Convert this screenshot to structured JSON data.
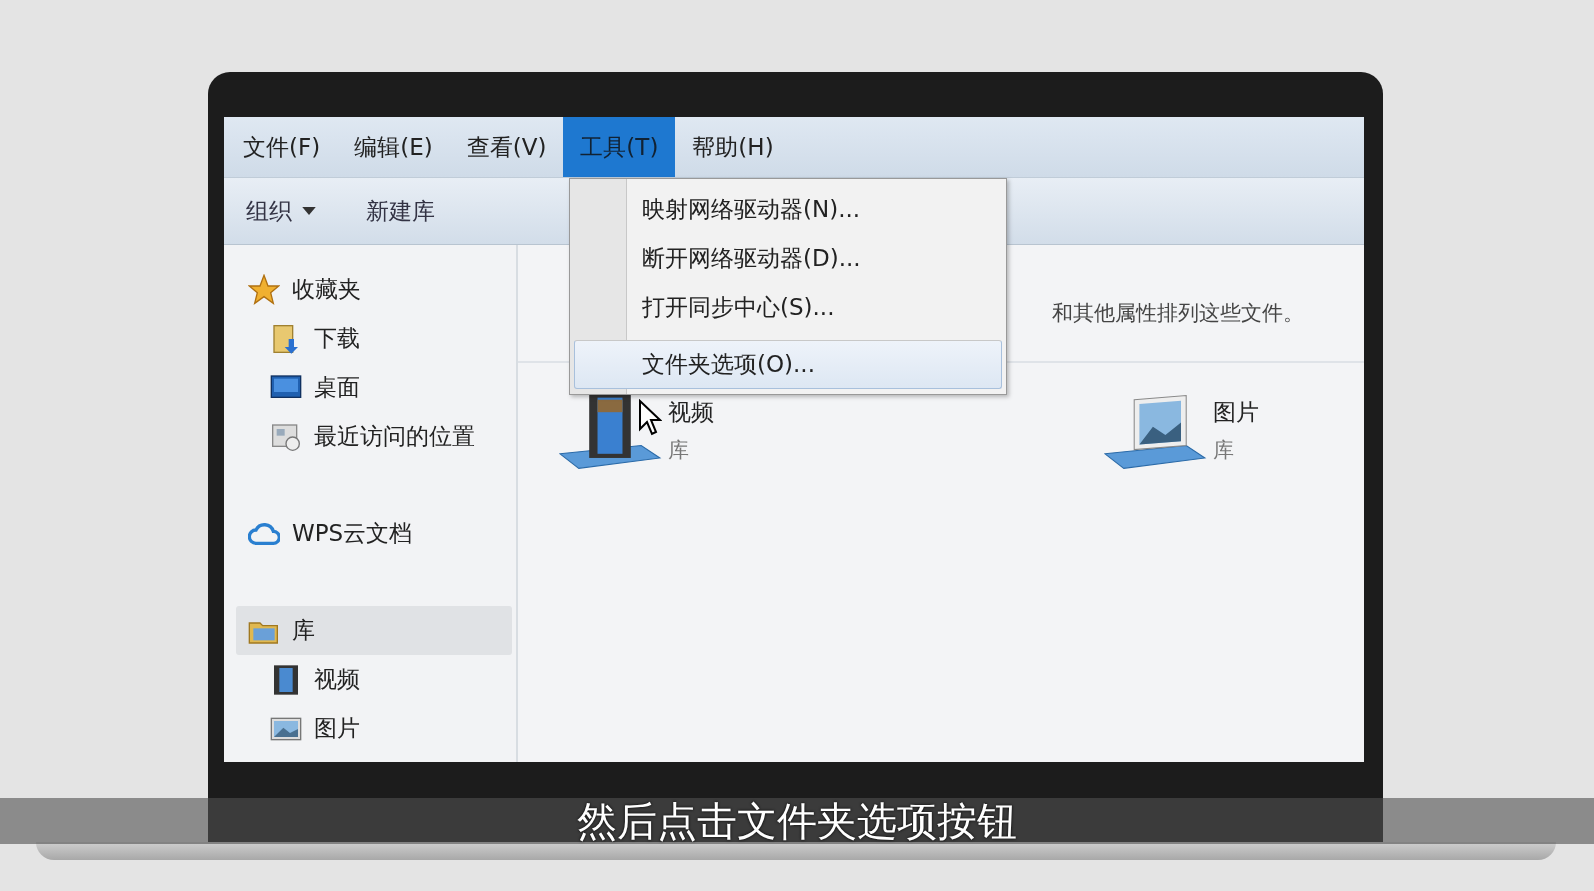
{
  "menubar": [
    {
      "label": "文件(F)",
      "selected": false
    },
    {
      "label": "编辑(E)",
      "selected": false
    },
    {
      "label": "查看(V)",
      "selected": false
    },
    {
      "label": "工具(T)",
      "selected": true
    },
    {
      "label": "帮助(H)",
      "selected": false
    }
  ],
  "toolbar": {
    "buttons": [
      {
        "label": "组织",
        "dropdown": true
      },
      {
        "label": "新建库",
        "dropdown": false
      }
    ]
  },
  "sidebar": {
    "items": [
      {
        "label": "收藏夹",
        "kind": "star",
        "selected": false,
        "children": [
          {
            "label": "下载",
            "kind": "download",
            "selected": false
          },
          {
            "label": "桌面",
            "kind": "desktop",
            "selected": false
          },
          {
            "label": "最近访问的位置",
            "kind": "recent",
            "selected": false
          }
        ]
      },
      {
        "label": "WPS云文档",
        "kind": "cloud",
        "selected": false
      },
      {
        "label": "库",
        "kind": "library",
        "selected": true,
        "children": [
          {
            "label": "视频",
            "kind": "video",
            "selected": false
          },
          {
            "label": "图片",
            "kind": "picture",
            "selected": false
          }
        ]
      }
    ]
  },
  "content": {
    "description": "和其他属性排列这些文件。",
    "libraries": [
      {
        "name": "视频",
        "subtitle": "库",
        "kind": "video"
      },
      {
        "name": "图片",
        "subtitle": "库",
        "kind": "picture"
      }
    ]
  },
  "tools_menu": {
    "items": [
      {
        "label": "映射网络驱动器(N)...",
        "selected": false,
        "separator_before": false
      },
      {
        "label": "断开网络驱动器(D)...",
        "selected": false,
        "separator_before": false
      },
      {
        "label": "打开同步中心(S)...",
        "selected": false,
        "separator_before": false
      },
      {
        "label": "文件夹选项(O)...",
        "selected": true,
        "separator_before": true
      }
    ]
  },
  "subtitle": "然后点击文件夹选项按钮"
}
